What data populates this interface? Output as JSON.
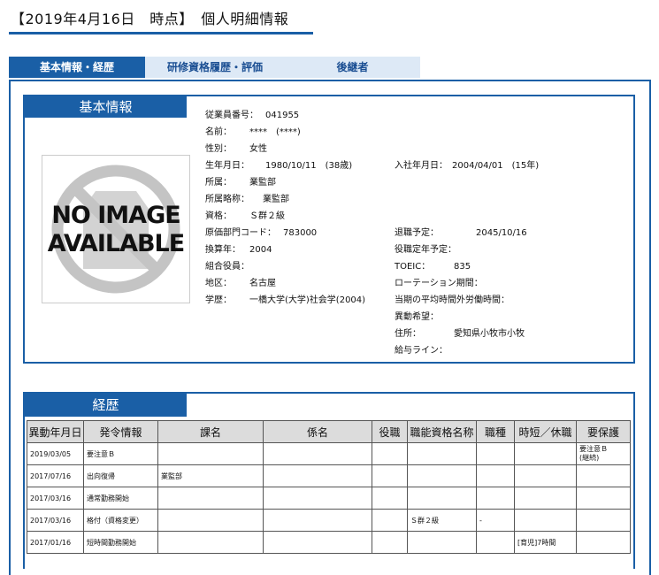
{
  "header": {
    "title": "【2019年4月16日　時点】　個人明細情報"
  },
  "tabs": [
    {
      "label": "基本情報・経歴"
    },
    {
      "label": "研修資格履歴・評価"
    },
    {
      "label": "後継者"
    }
  ],
  "basic": {
    "heading": "基本情報",
    "photo": {
      "line1": "NO IMAGE",
      "line2": "AVAILABLE"
    },
    "left": [
      {
        "label": "従業員番号：",
        "value": "041955"
      },
      {
        "label": "名前：",
        "value": "****　(****)"
      },
      {
        "label": "性別：",
        "value": "女性"
      },
      {
        "label": "生年月日：",
        "value": "1980/10/11　(38歳)"
      },
      {
        "label": "所属：",
        "value": "業監部"
      },
      {
        "label": "所属略称：",
        "value": "業監部"
      },
      {
        "label": "資格：",
        "value": "Ｓ群２級"
      },
      {
        "label": "原価部門コード：",
        "value": "783000"
      },
      {
        "label": "換算年：",
        "value": "2004"
      },
      {
        "label": "組合役員：",
        "value": ""
      },
      {
        "label": "地区：",
        "value": "名古屋"
      },
      {
        "label": "学歴：",
        "value": "一橋大学(大学)社会学(2004)"
      }
    ],
    "right": [
      {
        "label": "入社年月日：",
        "value": "2004/04/01　(15年)"
      },
      {
        "label": "退職予定：",
        "value": "2045/10/16"
      },
      {
        "label": "役職定年予定：",
        "value": ""
      },
      {
        "label": "TOEIC：",
        "value": "835"
      },
      {
        "label": "ローテーション期間：",
        "value": ""
      },
      {
        "label": "当期の平均時間外労働時間：",
        "value": ""
      },
      {
        "label": "異動希望：",
        "value": ""
      },
      {
        "label": "住所：",
        "value": "愛知県小牧市小牧"
      },
      {
        "label": "給与ライン：",
        "value": ""
      }
    ]
  },
  "history": {
    "heading": "経歴",
    "columns": [
      "異動年月日",
      "発令情報",
      "課名",
      "係名",
      "役職",
      "職能資格名称",
      "職種",
      "時短／休職",
      "要保護"
    ],
    "rows": [
      [
        "2019/03/05",
        "要注意Ｂ",
        "",
        "",
        "",
        "",
        "",
        "",
        "要注意Ｂ\n(継続)"
      ],
      [
        "2017/07/16",
        "出向復帰",
        "業監部",
        "",
        "",
        "",
        "",
        "",
        ""
      ],
      [
        "2017/03/16",
        "通常勤務開始",
        "",
        "",
        "",
        "",
        "",
        "",
        ""
      ],
      [
        "2017/03/16",
        "格付（資格変更）",
        "",
        "",
        "",
        "Ｓ群２級",
        "-",
        "",
        ""
      ],
      [
        "2017/01/16",
        "短時間勤務開始",
        "",
        "",
        "",
        "",
        "",
        "[育児]7時間",
        ""
      ]
    ]
  }
}
